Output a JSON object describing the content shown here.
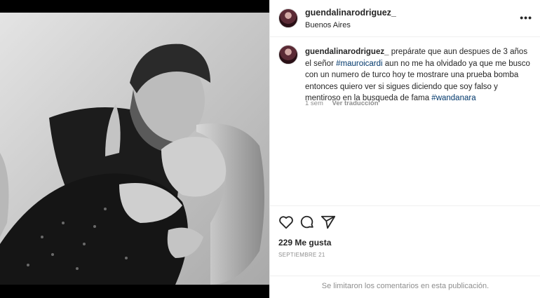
{
  "post": {
    "username": "guendalinarodriguez_",
    "location": "Buenos Aires",
    "caption": {
      "username": "guendalinarodriguez_",
      "text_1": " prepárate que aun despues de 3 años el señor ",
      "tag_1": "#mauroicardi",
      "text_2": " aun no me ha olvidado ya que me busco con un numero de turco hoy te mostrare una prueba bomba entonces quiero ver si sigues diciendo que soy falso y mentiroso en la busqueda de fama ",
      "tag_2": "#wandanara"
    },
    "time_ago": "1 sem",
    "translate_label": "Ver traducción",
    "likes": "229 Me gusta",
    "date": "SEPTIEMBRE 21",
    "comments_disabled": "Se limitaron los comentarios en esta publicación."
  },
  "icons": {
    "more": "more-options-icon",
    "like": "heart-icon",
    "comment": "comment-icon",
    "share": "share-icon"
  },
  "colors": {
    "hashtag": "#00376b",
    "muted": "#8e8e8e",
    "text": "#262626"
  }
}
